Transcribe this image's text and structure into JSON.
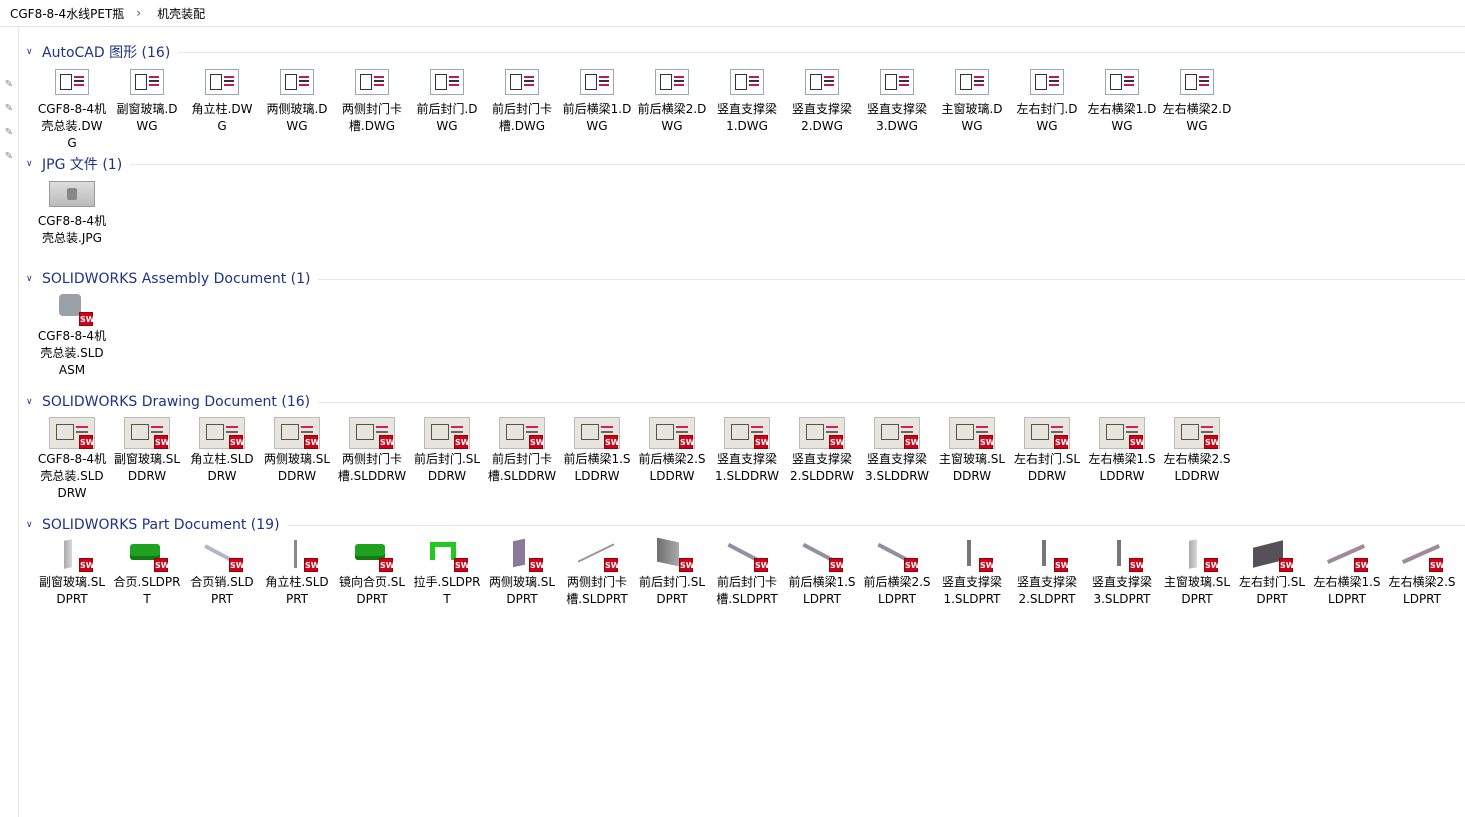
{
  "breadcrumb": {
    "items": [
      "CGF8-8-4水线PET瓶",
      "机壳装配"
    ],
    "separator": "›"
  },
  "groups": [
    {
      "title": "AutoCAD 图形 (16)",
      "kind": "dwg",
      "items": [
        "CGF8-8-4机壳总装.DWG",
        "副窗玻璃.DWG",
        "角立柱.DWG",
        "两侧玻璃.DWG",
        "两侧封门卡槽.DWG",
        "前后封门.DWG",
        "前后封门卡槽.DWG",
        "前后横梁1.DWG",
        "前后横梁2.DWG",
        "竖直支撑梁1.DWG",
        "竖直支撑梁2.DWG",
        "竖直支撑梁3.DWG",
        "主窗玻璃.DWG",
        "左右封门.DWG",
        "左右横梁1.DWG",
        "左右横梁2.DWG"
      ]
    },
    {
      "title": "JPG 文件 (1)",
      "kind": "jpg",
      "items": [
        "CGF8-8-4机壳总装.JPG"
      ]
    },
    {
      "title": "SOLIDWORKS Assembly Document (1)",
      "kind": "asm",
      "items": [
        "CGF8-8-4机壳总装.SLDASM"
      ]
    },
    {
      "title": "SOLIDWORKS Drawing Document (16)",
      "kind": "drw",
      "items": [
        "CGF8-8-4机壳总装.SLDDRW",
        "副窗玻璃.SLDDRW",
        "角立柱.SLDDRW",
        "两侧玻璃.SLDDRW",
        "两侧封门卡槽.SLDDRW",
        "前后封门.SLDDRW",
        "前后封门卡槽.SLDDRW",
        "前后横梁1.SLDDRW",
        "前后横梁2.SLDDRW",
        "竖直支撑梁1.SLDDRW",
        "竖直支撑梁2.SLDDRW",
        "竖直支撑梁3.SLDDRW",
        "主窗玻璃.SLDDRW",
        "左右封门.SLDDRW",
        "左右横梁1.SLDDRW",
        "左右横梁2.SLDDRW"
      ]
    },
    {
      "title": "SOLIDWORKS Part Document (19)",
      "kind": "prt",
      "items": [
        "副窗玻璃.SLDPRT",
        "合页.SLDPRT",
        "合页销.SLDPRT",
        "角立柱.SLDPRT",
        "镜向合页.SLDPRT",
        "拉手.SLDPRT",
        "两侧玻璃.SLDPRT",
        "两侧封门卡槽.SLDPRT",
        "前后封门.SLDPRT",
        "前后封门卡槽.SLDPRT",
        "前后横梁1.SLDPRT",
        "前后横梁2.SLDPRT",
        "竖直支撑梁1.SLDPRT",
        "竖直支撑梁2.SLDPRT",
        "竖直支撑梁3.SLDPRT",
        "主窗玻璃.SLDPRT",
        "左右封门.SLDPRT",
        "左右横梁1.SLDPRT",
        "左右横梁2.SLDPRT"
      ],
      "shapes": [
        "plate",
        "green",
        "rod",
        "post",
        "green",
        "handle",
        "glass",
        "line",
        "door",
        "beam",
        "beam",
        "beam",
        "vert",
        "vert",
        "vert",
        "plate",
        "dark",
        "rail",
        "rail"
      ]
    }
  ],
  "sw_badge": "SW",
  "colors": {
    "group_title": "#1e3287",
    "sw_badge": "#d0021b"
  }
}
